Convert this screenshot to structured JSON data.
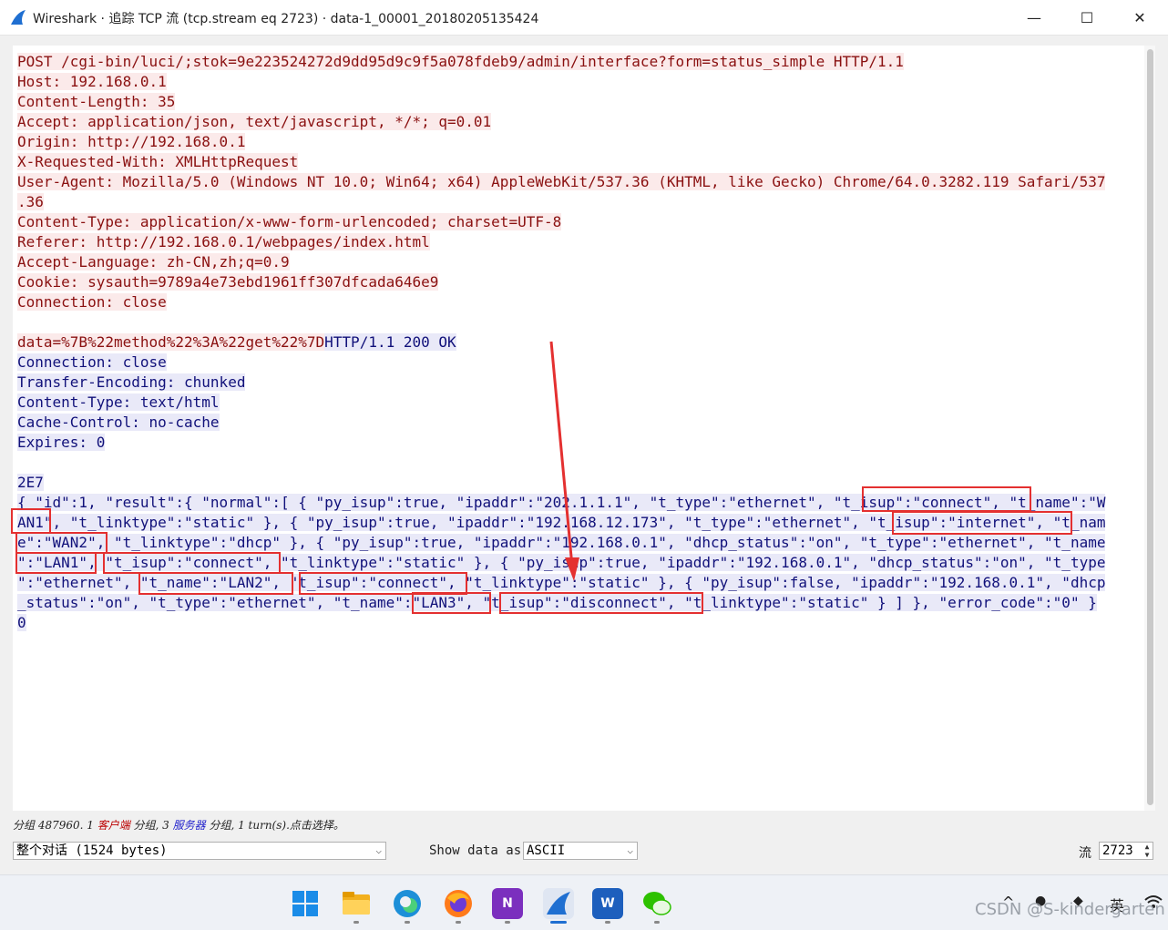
{
  "window": {
    "title": "Wireshark · 追踪 TCP 流 (tcp.stream eq 2723) · data-1_00001_20180205135424",
    "controls": {
      "minimize": "—",
      "maximize": "☐",
      "close": "✕"
    }
  },
  "stream": {
    "request_lines": [
      "POST /cgi-bin/luci/;stok=9e223524272d9dd95d9c9f5a078fdeb9/admin/interface?form=status_simple HTTP/1.1",
      "Host: 192.168.0.1",
      "Content-Length: 35",
      "Accept: application/json, text/javascript, */*; q=0.01",
      "Origin: http://192.168.0.1",
      "X-Requested-With: XMLHttpRequest",
      "User-Agent: Mozilla/5.0 (Windows NT 10.0; Win64; x64) AppleWebKit/537.36 (KHTML, like Gecko) Chrome/64.0.3282.119 Safari/537",
      ".36",
      "Content-Type: application/x-www-form-urlencoded; charset=UTF-8",
      "Referer: http://192.168.0.1/webpages/index.html",
      "Accept-Language: zh-CN,zh;q=0.9",
      "Cookie: sysauth=9789a4e73ebd1961ff307dfcada646e9",
      "Connection: close"
    ],
    "request_body": "data=%7B%22method%22%3A%22get%22%7D",
    "response_status": "HTTP/1.1 200 OK",
    "response_headers": [
      "Connection: close",
      "Transfer-Encoding: chunked",
      "Content-Type: text/html",
      "Cache-Control: no-cache",
      "Expires: 0"
    ],
    "chunk_size": "2E7",
    "body_lines": [
      "{ \"id\":1, \"result\":{ \"normal\":[ { \"py_isup\":true, \"ipaddr\":\"202.1.1.1\", \"t_type\":\"ethernet\", \"t_isup\":\"connect\", \"t_name\":\"W",
      "AN1\", \"t_linktype\":\"static\" }, { \"py_isup\":true, \"ipaddr\":\"192.168.12.173\", \"t_type\":\"ethernet\", \"t_isup\":\"internet\", \"t_nam",
      "e\":\"WAN2\", \"t_linktype\":\"dhcp\" }, { \"py_isup\":true, \"ipaddr\":\"192.168.0.1\", \"dhcp_status\":\"on\", \"t_type\":\"ethernet\", \"t_name",
      "\":\"LAN1\", \"t_isup\":\"connect\", \"t_linktype\":\"static\" }, { \"py_isup\":true, \"ipaddr\":\"192.168.0.1\", \"dhcp_status\":\"on\", \"t_type",
      "\":\"ethernet\", \"t_name\":\"LAN2\", \"t_isup\":\"connect\", \"t_linktype\":\"static\" }, { \"py_isup\":false, \"ipaddr\":\"192.168.0.1\", \"dhcp",
      "_status\":\"on\", \"t_type\":\"ethernet\", \"t_name\":\"LAN3\", \"t_isup\":\"disconnect\", \"t_linktype\":\"static\" } ] }, \"error_code\":\"0\" }"
    ],
    "chunk_end": "0",
    "client_color": "#8a1010",
    "server_color": "#11117a",
    "highlight_color": "#e43030"
  },
  "status_bar": {
    "part1": "分组 487960. 1 ",
    "client_label": "客户端",
    "part2": " 分组, 3 ",
    "server_label": "服务器",
    "part3": " 分组, 1 turn(s).点击选择。"
  },
  "controls": {
    "conversation_select": "整个对话 (1524 bytes)",
    "show_data_label": "Show data as",
    "show_data_value": "ASCII",
    "stream_label": "流",
    "stream_value": "2723"
  },
  "taskbar": {
    "icons": [
      "windows-start-icon",
      "file-explorer-icon",
      "edge-browser-icon",
      "firefox-icon",
      "onenote-icon",
      "wireshark-icon",
      "word-icon",
      "wechat-icon"
    ],
    "onenote_letter": "N",
    "word_letter": "W",
    "tray_chevron": "^",
    "ime_label": "英"
  },
  "watermark": "CSDN @S-kindergarten"
}
